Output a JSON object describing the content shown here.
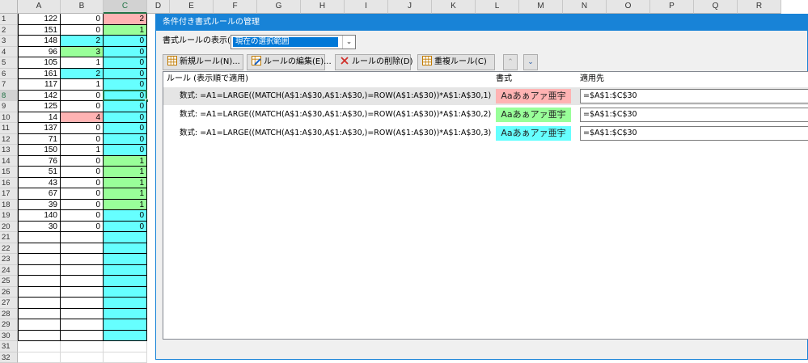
{
  "spreadsheet": {
    "columns": [
      "A",
      "B",
      "C",
      "D",
      "E",
      "F",
      "G",
      "H",
      "I",
      "J",
      "K",
      "L",
      "M",
      "N",
      "O",
      "P",
      "Q",
      "R"
    ],
    "rows": [
      {
        "n": "1",
        "a": "122",
        "b": "0",
        "c": "2"
      },
      {
        "n": "2",
        "a": "151",
        "b": "0",
        "c": "1"
      },
      {
        "n": "3",
        "a": "148",
        "b": "2",
        "c": "0"
      },
      {
        "n": "4",
        "a": "96",
        "b": "3",
        "c": "0"
      },
      {
        "n": "5",
        "a": "105",
        "b": "1",
        "c": "0"
      },
      {
        "n": "6",
        "a": "161",
        "b": "2",
        "c": "0"
      },
      {
        "n": "7",
        "a": "117",
        "b": "1",
        "c": "0"
      },
      {
        "n": "8",
        "a": "142",
        "b": "0",
        "c": "0"
      },
      {
        "n": "9",
        "a": "125",
        "b": "0",
        "c": "0"
      },
      {
        "n": "10",
        "a": "14",
        "b": "4",
        "c": "0"
      },
      {
        "n": "11",
        "a": "137",
        "b": "0",
        "c": "0"
      },
      {
        "n": "12",
        "a": "71",
        "b": "0",
        "c": "0"
      },
      {
        "n": "13",
        "a": "150",
        "b": "1",
        "c": "0"
      },
      {
        "n": "14",
        "a": "76",
        "b": "0",
        "c": "1"
      },
      {
        "n": "15",
        "a": "51",
        "b": "0",
        "c": "1"
      },
      {
        "n": "16",
        "a": "43",
        "b": "0",
        "c": "1"
      },
      {
        "n": "17",
        "a": "67",
        "b": "0",
        "c": "1"
      },
      {
        "n": "18",
        "a": "39",
        "b": "0",
        "c": "1"
      },
      {
        "n": "19",
        "a": "140",
        "b": "0",
        "c": "0"
      },
      {
        "n": "20",
        "a": "30",
        "b": "0",
        "c": "0"
      },
      {
        "n": "21",
        "a": "",
        "b": "",
        "c": ""
      },
      {
        "n": "22",
        "a": "",
        "b": "",
        "c": ""
      },
      {
        "n": "23",
        "a": "",
        "b": "",
        "c": ""
      },
      {
        "n": "24",
        "a": "",
        "b": "",
        "c": ""
      },
      {
        "n": "25",
        "a": "",
        "b": "",
        "c": ""
      },
      {
        "n": "26",
        "a": "",
        "b": "",
        "c": ""
      },
      {
        "n": "27",
        "a": "",
        "b": "",
        "c": ""
      },
      {
        "n": "28",
        "a": "",
        "b": "",
        "c": ""
      },
      {
        "n": "29",
        "a": "",
        "b": "",
        "c": ""
      },
      {
        "n": "30",
        "a": "",
        "b": "",
        "c": ""
      },
      {
        "n": "31",
        "a": "",
        "b": "",
        "c": ""
      },
      {
        "n": "32",
        "a": "",
        "b": "",
        "c": ""
      }
    ],
    "b_fills": {
      "3": "#66ffff",
      "4": "#99ff99",
      "6": "#66ffff",
      "10": "#ffb3b3"
    },
    "c_fills": {
      "1": "#ffb3b3",
      "2": "#99ff99",
      "14": "#99ff99",
      "15": "#99ff99",
      "16": "#99ff99",
      "17": "#99ff99",
      "18": "#99ff99"
    },
    "c_default_fill": "#66ffff",
    "active_row": "8"
  },
  "dialog": {
    "title": "条件付き書式ルールの管理",
    "show_rules_label": "書式ルールの表示(S):",
    "show_rules_value": "現在の選択範囲",
    "buttons": {
      "new_rule": "新規ルール(N)...",
      "edit_rule": "ルールの編集(E)...",
      "delete_rule": "ルールの削除(D)",
      "duplicate_rule": "重複ルール(C)"
    },
    "headers": {
      "rule": "ルール (表示順で適用)",
      "format": "書式",
      "applies_to": "適用先"
    },
    "rules": [
      {
        "formula": "数式: =A1=LARGE((MATCH(A$1:A$30,A$1:A$30,)=ROW(A$1:A$30))*A$1:A$30,1)",
        "preview": "Aaあぁアァ亜宇",
        "color": "#ffb3b3",
        "applies": "=$A$1:$C$30"
      },
      {
        "formula": "数式: =A1=LARGE((MATCH(A$1:A$30,A$1:A$30,)=ROW(A$1:A$30))*A$1:A$30,2)",
        "preview": "Aaあぁアァ亜宇",
        "color": "#99ff99",
        "applies": "=$A$1:$C$30"
      },
      {
        "formula": "数式: =A1=LARGE((MATCH(A$1:A$30,A$1:A$30,)=ROW(A$1:A$30))*A$1:A$30,3)",
        "preview": "Aaあぁアァ亜宇",
        "color": "#66ffff",
        "applies": "=$A$1:$C$30"
      }
    ],
    "accent_color": "#1883d7"
  }
}
